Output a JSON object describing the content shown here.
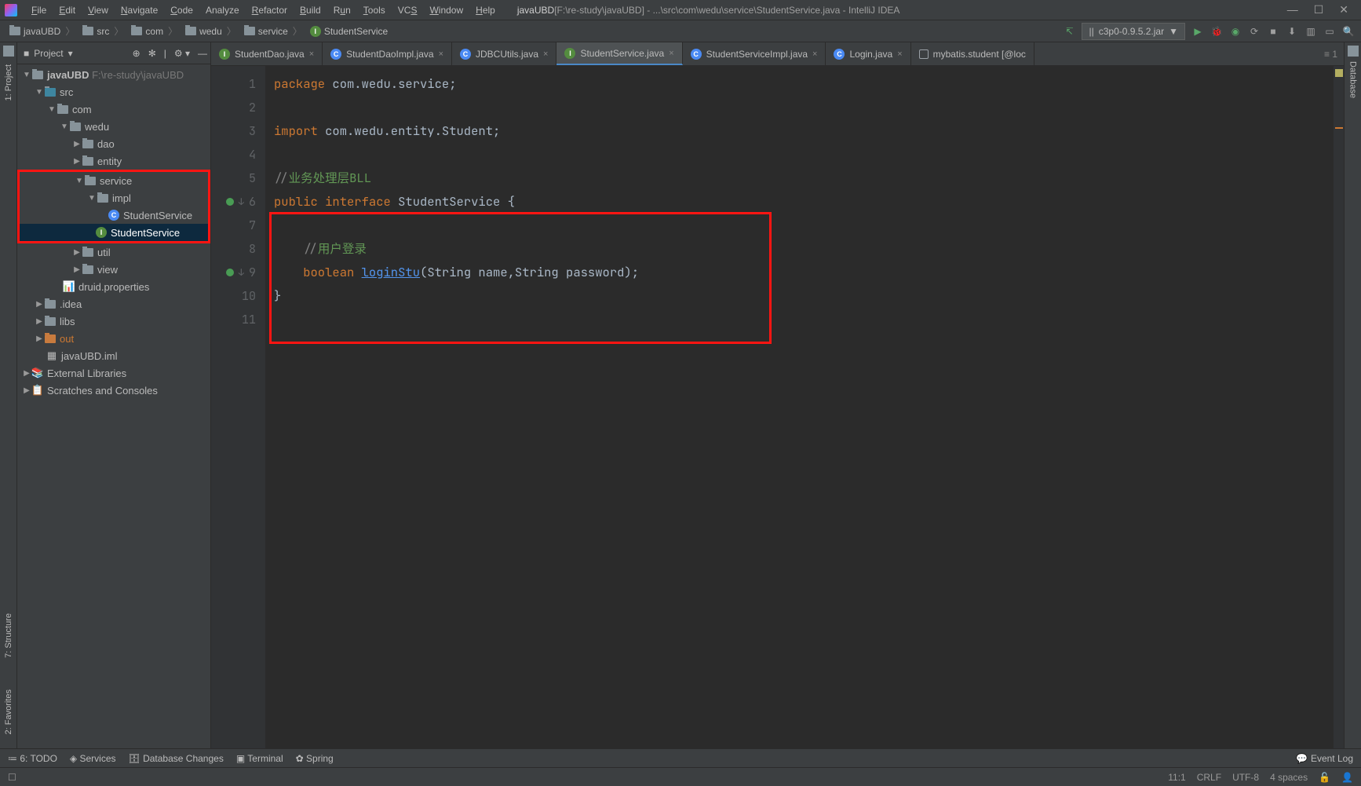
{
  "title": {
    "project": "javaUBD",
    "path_prefix": "[F:\\re-study\\javaUBD] - ",
    "path_suffix": "...\\src\\com\\wedu\\service\\StudentService.java - IntelliJ IDEA"
  },
  "menu": {
    "file": "File",
    "edit": "Edit",
    "view": "View",
    "navigate": "Navigate",
    "code": "Code",
    "analyze": "Analyze",
    "refactor": "Refactor",
    "build": "Build",
    "run": "Run",
    "tools": "Tools",
    "vcs": "VCS",
    "window": "Window",
    "help": "Help"
  },
  "breadcrumbs": {
    "c0": "javaUBD",
    "c1": "src",
    "c2": "com",
    "c3": "wedu",
    "c4": "service",
    "c5": "StudentService"
  },
  "runconfig": "c3p0-0.9.5.2.jar",
  "project_panel": {
    "title": "Project"
  },
  "tree": {
    "root": "javaUBD",
    "root_path": "F:\\re-study\\javaUBD",
    "src": "src",
    "com": "com",
    "wedu": "wedu",
    "dao": "dao",
    "entity": "entity",
    "service": "service",
    "impl": "impl",
    "studentserviceimpl": "StudentService",
    "studentservice": "StudentService",
    "util": "util",
    "view": "view",
    "druid": "druid.properties",
    "idea": ".idea",
    "libs": "libs",
    "out": "out",
    "iml": "javaUBD.iml",
    "extlib": "External Libraries",
    "scratches": "Scratches and Consoles"
  },
  "tabs": {
    "t0": "StudentDao.java",
    "t1": "StudentDaoImpl.java",
    "t2": "JDBCUtils.java",
    "t3": "StudentService.java",
    "t4": "StudentServiceImpl.java",
    "t5": "Login.java",
    "t6": "mybatis.student [@loc"
  },
  "code": {
    "l1_kw": "package ",
    "l1_pkg": "com.wedu.service",
    "l3_kw": "import ",
    "l3_pkg": "com.wedu.entity.Student",
    "l5_a": "//",
    "l5_b": "业务处理层BLL",
    "l6_kw1": "public interface ",
    "l6_name": "StudentService ",
    "l8": "    //",
    "l8b": "用户登录",
    "l9_kw": "    boolean ",
    "l9_m": "loginStu",
    "l9_rest": "(String name,String password);"
  },
  "gutter": {
    "n1": "1",
    "n2": "2",
    "n3": "3",
    "n4": "4",
    "n5": "5",
    "n6": "6",
    "n7": "7",
    "n8": "8",
    "n9": "9",
    "n10": "10",
    "n11": "11"
  },
  "bottom": {
    "todo": "6: TODO",
    "services": "Services",
    "db": "Database Changes",
    "terminal": "Terminal",
    "spring": "Spring",
    "eventlog": "Event Log"
  },
  "status": {
    "pos": "11:1",
    "crlf": "CRLF",
    "enc": "UTF-8",
    "indent": "4 spaces"
  },
  "sidebars": {
    "project": "1: Project",
    "structure": "7: Structure",
    "favorites": "2: Favorites",
    "database": "Database"
  },
  "tabs_counter": "≡ 1"
}
